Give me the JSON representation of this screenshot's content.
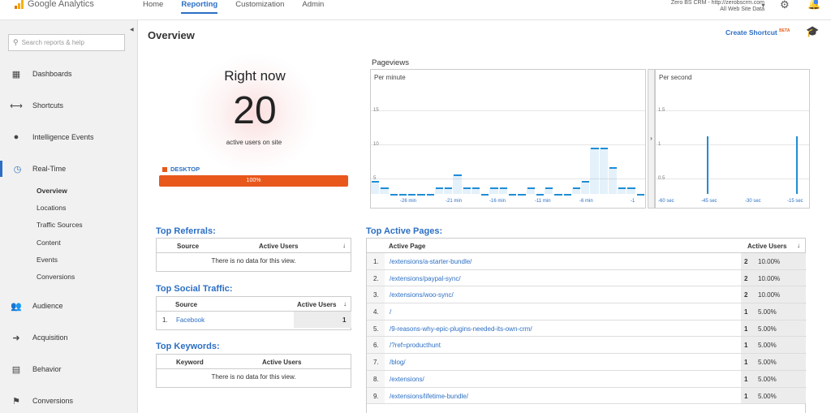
{
  "app": {
    "name": "Google Analytics"
  },
  "nav": {
    "home": "Home",
    "reporting": "Reporting",
    "customization": "Customization",
    "admin": "Admin"
  },
  "account": {
    "line1": "Zero BS CRM - http://zerobscrm.com",
    "line2": "All Web Site Data"
  },
  "sidebar": {
    "search_placeholder": "Search reports & help",
    "dashboards": "Dashboards",
    "shortcuts": "Shortcuts",
    "intelligence": "Intelligence Events",
    "realtime": "Real-Time",
    "realtime_sub": [
      "Overview",
      "Locations",
      "Traffic Sources",
      "Content",
      "Events",
      "Conversions"
    ],
    "audience": "Audience",
    "acquisition": "Acquisition",
    "behavior": "Behavior",
    "conversions": "Conversions"
  },
  "page": {
    "title": "Overview",
    "create_shortcut": "Create Shortcut",
    "beta": "BETA"
  },
  "rightnow": {
    "label": "Right now",
    "count": "20",
    "sublabel": "active users on site",
    "device": "DESKTOP",
    "device_pct": "100%"
  },
  "pageviews": {
    "title": "Pageviews",
    "per_minute": "Per minute",
    "per_second": "Per second",
    "minute_yticks": [
      "15",
      "10",
      "5"
    ],
    "minute_xticks": [
      "-26 min",
      "-21 min",
      "-16 min",
      "-11 min",
      "-6 min",
      "-1"
    ],
    "second_yticks": [
      "1.5",
      "1",
      "0.5"
    ],
    "second_xticks": [
      "-60 sec",
      "-45 sec",
      "-30 sec",
      "-15 sec"
    ]
  },
  "chart_data": [
    {
      "type": "bar",
      "title": "Per minute",
      "ylim": [
        0,
        18
      ],
      "x": [
        -30,
        -29,
        -28,
        -27,
        -26,
        -25,
        -24,
        -23,
        -22,
        -21,
        -20,
        -19,
        -18,
        -17,
        -16,
        -15,
        -14,
        -13,
        -12,
        -11,
        -10,
        -9,
        -8,
        -7,
        -6,
        -5,
        -4,
        -3,
        -2,
        -1
      ],
      "values": [
        2,
        1,
        0,
        0,
        0,
        0,
        0,
        1,
        1,
        3,
        1,
        1,
        0,
        1,
        1,
        0,
        0,
        1,
        0,
        1,
        0,
        0,
        1,
        2,
        7,
        7,
        4,
        1,
        1,
        0
      ]
    },
    {
      "type": "bar",
      "title": "Per second",
      "ylim": [
        0,
        2
      ],
      "x": [
        -60,
        -40,
        -5
      ],
      "values": [
        0,
        1,
        1
      ]
    }
  ],
  "referrals": {
    "title": "Top Referrals:",
    "col_source": "Source",
    "col_active": "Active Users",
    "empty": "There is no data for this view."
  },
  "social": {
    "title": "Top Social Traffic:",
    "col_source": "Source",
    "col_active": "Active Users",
    "rows": [
      {
        "n": "1.",
        "source": "Facebook",
        "users": "1"
      }
    ]
  },
  "keywords": {
    "title": "Top Keywords:",
    "col_keyword": "Keyword",
    "col_active": "Active Users",
    "empty": "There is no data for this view."
  },
  "pages": {
    "title": "Top Active Pages:",
    "col_page": "Active Page",
    "col_active": "Active Users",
    "rows": [
      {
        "n": "1.",
        "page": "/extensions/a-starter-bundle/",
        "users": "2",
        "pct": "10.00%"
      },
      {
        "n": "2.",
        "page": "/extensions/paypal-sync/",
        "users": "2",
        "pct": "10.00%"
      },
      {
        "n": "3.",
        "page": "/extensions/woo-sync/",
        "users": "2",
        "pct": "10.00%"
      },
      {
        "n": "4.",
        "page": "/",
        "users": "1",
        "pct": "5.00%"
      },
      {
        "n": "5.",
        "page": "/9-reasons-why-epic-plugins-needed-its-own-crm/",
        "users": "1",
        "pct": "5.00%"
      },
      {
        "n": "6.",
        "page": "/?ref=producthunt",
        "users": "1",
        "pct": "5.00%"
      },
      {
        "n": "7.",
        "page": "/blog/",
        "users": "1",
        "pct": "5.00%"
      },
      {
        "n": "8.",
        "page": "/extensions/",
        "users": "1",
        "pct": "5.00%"
      },
      {
        "n": "9.",
        "page": "/extensions/lifetime-bundle/",
        "users": "1",
        "pct": "5.00%"
      }
    ]
  }
}
